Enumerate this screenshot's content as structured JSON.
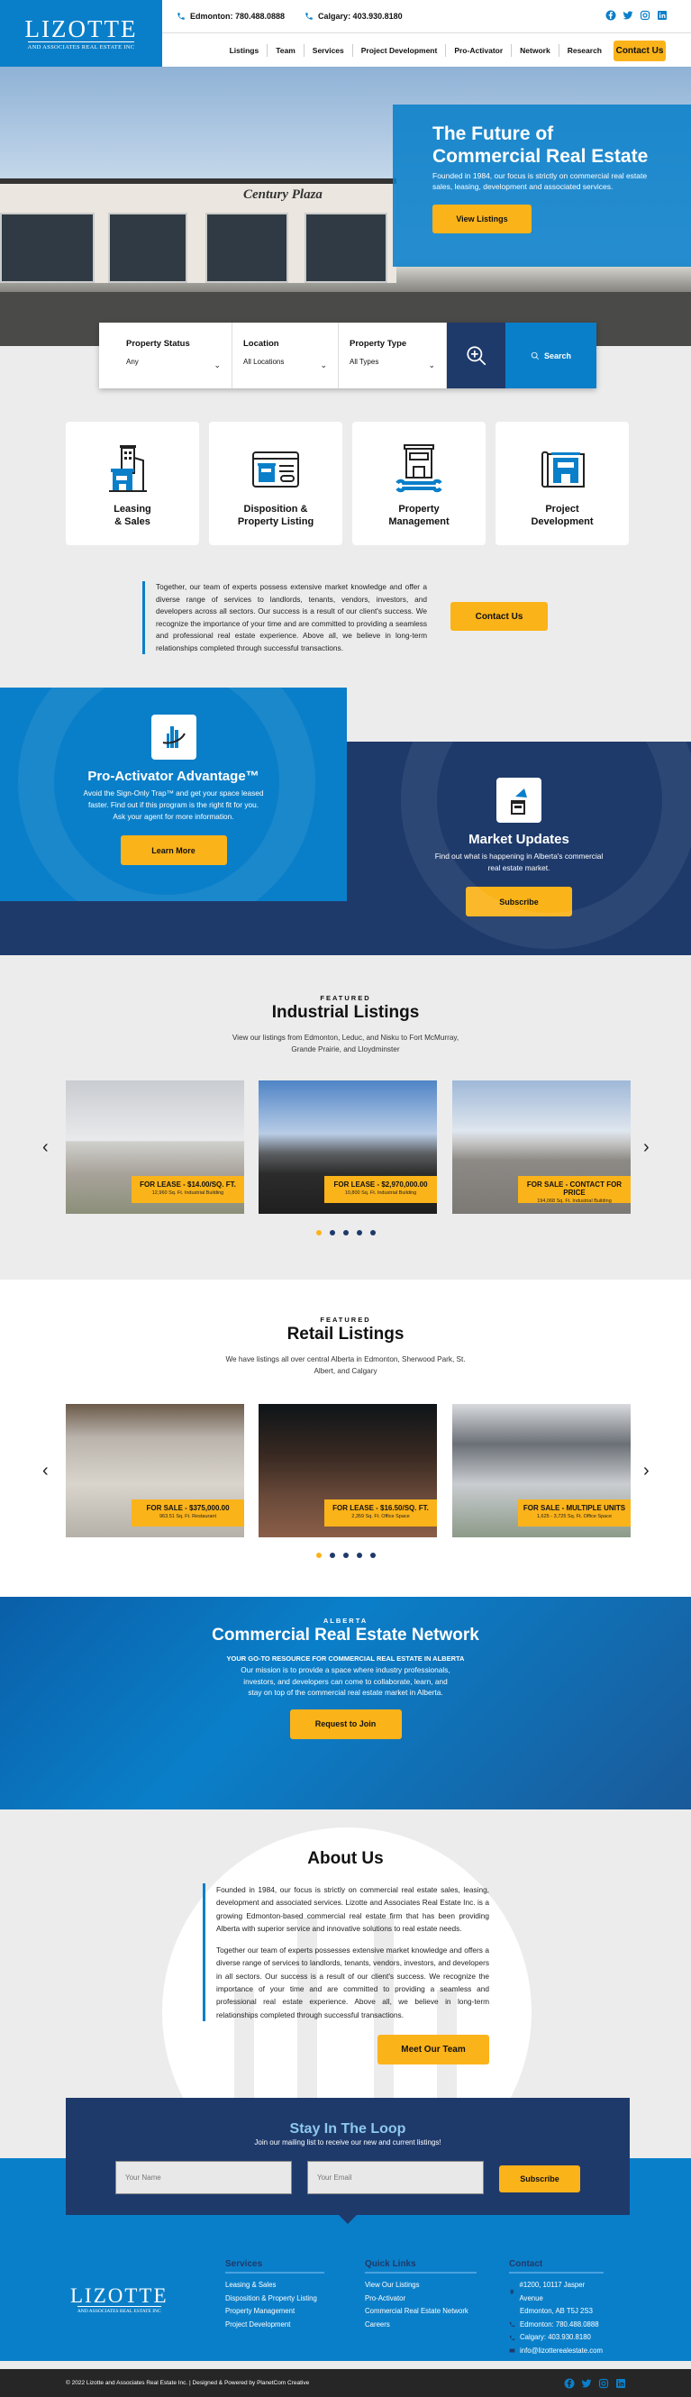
{
  "brand": {
    "name": "LIZOTTE",
    "tagline": "AND ASSOCIATES REAL ESTATE INC",
    "accent": "#0a7fc9",
    "navy": "#1e3a6b",
    "yellow": "#fbb31a"
  },
  "topbar": {
    "phones": [
      {
        "icon": "phone-icon",
        "text": "Edmonton: 780.488.0888"
      },
      {
        "icon": "phone-icon",
        "text": "Calgary: 403.930.8180"
      }
    ],
    "social": [
      "facebook-icon",
      "twitter-icon",
      "instagram-icon",
      "linkedin-icon"
    ]
  },
  "nav": {
    "items": [
      "Listings",
      "Team",
      "Services",
      "Project Development",
      "Pro-Activator",
      "Network",
      "Research"
    ],
    "contact": "Contact Us"
  },
  "hero": {
    "title": "The Future of Commercial Real Estate",
    "text": "Founded in 1984, our focus is strictly on commercial real estate sales, leasing, development and associated services.",
    "button": "View Listings",
    "sign": "Century Plaza"
  },
  "search": {
    "fields": [
      {
        "label": "Property Status",
        "value": "Any"
      },
      {
        "label": "Location",
        "value": "All Locations"
      },
      {
        "label": "Property Type",
        "value": "All Types"
      }
    ],
    "advanced_icon": "zoom-in-icon",
    "button": "Search"
  },
  "services": [
    {
      "label1": "Leasing",
      "label2": "& Sales",
      "icon": "buildings-icon"
    },
    {
      "label1": "Disposition &",
      "label2": "Property Listing",
      "icon": "browser-listing-icon"
    },
    {
      "label1": "Property",
      "label2": "Management",
      "icon": "building-wrench-icon"
    },
    {
      "label1": "Project",
      "label2": "Development",
      "icon": "blueprint-icon"
    }
  ],
  "intro": {
    "text": "Together, our team of experts possess extensive market knowledge and offer a diverse range of services to landlords, tenants, vendors, investors, and developers across all sectors. Our success is a result of our client's success. We recognize the importance of your time and are committed to providing a seamless and professional real estate experience. Above all, we believe in long-term relationships completed through successful transactions.",
    "button": "Contact Us"
  },
  "proactivator": {
    "title": "Pro-Activator Advantage™",
    "text": "Avoid the Sign-Only Trap™ and get your space leased faster. Find out if this program is the right fit for you. Ask your agent for more information.",
    "button": "Learn More"
  },
  "market": {
    "title": "Market Updates",
    "text": "Find out what is happening in Alberta's commercial real estate market.",
    "button": "Subscribe"
  },
  "industrial": {
    "kicker": "FEATURED",
    "title": "Industrial Listings",
    "text": "View our listings from Edmonton, Leduc, and Nisku to Fort McMurray, Grande Prairie, and Lloydminster",
    "cards": [
      {
        "price": "FOR LEASE - $14.00/SQ. FT.",
        "detail": "12,960 Sq. Ft. Industrial Building"
      },
      {
        "price": "FOR LEASE - $2,970,000.00",
        "detail": "10,800 Sq. Ft. Industrial Building"
      },
      {
        "price": "FOR SALE - CONTACT FOR PRICE",
        "detail": "194,068 Sq. Ft. Industrial Building"
      }
    ],
    "pages": 5,
    "active_page": 1
  },
  "retail": {
    "kicker": "FEATURED",
    "title": "Retail Listings",
    "text": "We have listings all over central Alberta in Edmonton, Sherwood Park, St. Albert, and Calgary",
    "cards": [
      {
        "price": "FOR SALE - $375,000.00",
        "detail": "963.51 Sq. Ft. Restaurant"
      },
      {
        "price": "FOR LEASE - $16.50/SQ. FT.",
        "detail": "2,359 Sq. Ft. Office Space"
      },
      {
        "price": "FOR SALE - MULTIPLE UNITS",
        "detail": "1,625 - 3,725 Sq. Ft. Office Space"
      }
    ],
    "pages": 5,
    "active_page": 1
  },
  "network": {
    "kicker": "ALBERTA",
    "title": "Commercial Real Estate Network",
    "subtitle": "YOUR GO-TO RESOURCE FOR COMMERCIAL REAL ESTATE IN ALBERTA",
    "text": "Our mission is to provide a space where industry professionals, investors, and developers can come to collaborate, learn, and stay on top of the commercial real estate market in Alberta.",
    "button": "Request to Join"
  },
  "about": {
    "title": "About Us",
    "p1": "Founded in 1984, our focus is strictly on commercial real estate sales, leasing, development and associated services. Lizotte and Associates Real Estate Inc. is a growing Edmonton-based commercial real estate firm that has been providing Alberta with superior service and innovative solutions to real estate needs.",
    "p2": "Together our team of experts possesses extensive market knowledge and offers a diverse range of services to landlords, tenants, vendors, investors, and developers in all sectors. Our success is a result of our client's success. We recognize the importance of your time and are committed to providing a seamless and professional real estate experience. Above all, we believe in long-term relationships completed through successful transactions.",
    "button": "Meet Our Team"
  },
  "newsletter": {
    "title": "Stay In The Loop",
    "subtitle": "Join our mailing list to receive our new and current listings!",
    "name_placeholder": "Your Name",
    "email_placeholder": "Your Email",
    "button": "Subscribe"
  },
  "footer": {
    "services": {
      "title": "Services",
      "links": [
        "Leasing & Sales",
        "Disposition & Property Listing",
        "Property Management",
        "Project Development"
      ]
    },
    "quick": {
      "title": "Quick Links",
      "links": [
        "View Our Listings",
        "Pro-Activator",
        "Commercial Real Estate Network",
        "Careers"
      ]
    },
    "contact": {
      "title": "Contact",
      "address1": "#1200, 10117 Jasper Avenue",
      "address2": "Edmonton, AB T5J 2S3",
      "edmonton": "Edmonton: 780.488.0888",
      "calgary": "Calgary: 403.930.8180",
      "email": "info@lizotterealestate.com"
    },
    "copyright": "© 2022 Lizotte and Associates Real Estate Inc. | Designed & Powered by PlanetCom Creative"
  }
}
